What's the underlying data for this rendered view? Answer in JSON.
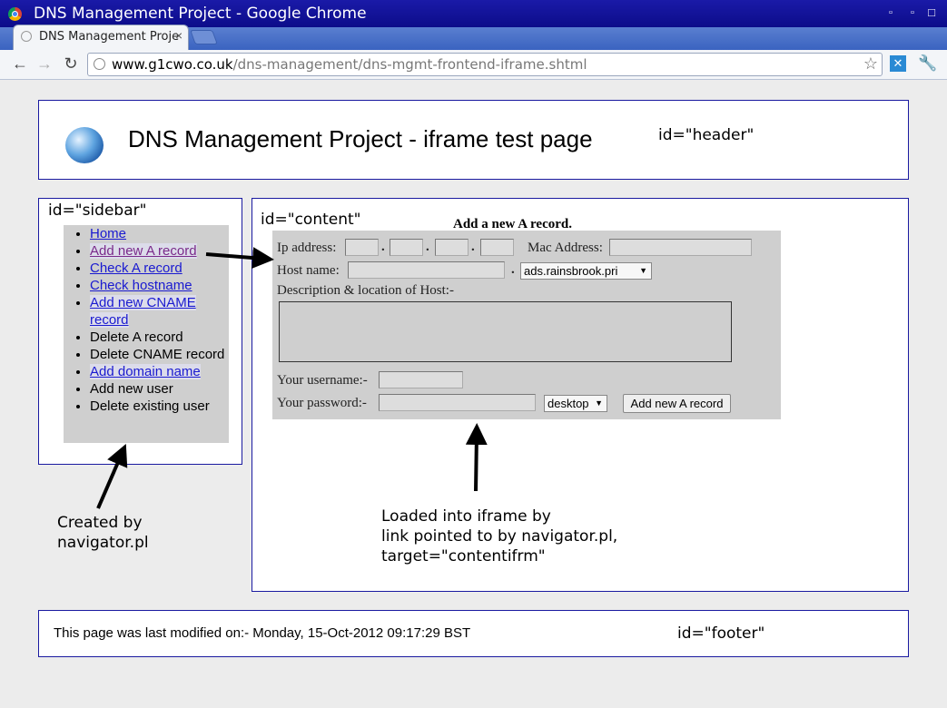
{
  "window": {
    "title": "DNS Management Project - Google Chrome",
    "min": "▫",
    "max": "▫",
    "close": "□"
  },
  "tab": {
    "title": "DNS Management Projec",
    "close": "×"
  },
  "toolbar": {
    "back": "←",
    "forward": "→",
    "reload": "↻",
    "url_domain": "www.g1cwo.co.uk",
    "url_path": "/dns-management/dns-mgmt-frontend-iframe.shtml",
    "star": "☆",
    "wrench": "🔧"
  },
  "header": {
    "title": "DNS Management Project - iframe test page",
    "id_label": "id=\"header\""
  },
  "sidebar": {
    "id_label": "id=\"sidebar\"",
    "items": [
      {
        "label": "Home",
        "link": true
      },
      {
        "label": "Add new A record",
        "link": true
      },
      {
        "label": "Check A record",
        "link": true
      },
      {
        "label": "Check hostname",
        "link": true
      },
      {
        "label": "Add new CNAME record",
        "link": true
      },
      {
        "label": "Delete A record",
        "link": false
      },
      {
        "label": "Delete CNAME record",
        "link": false
      },
      {
        "label": "Add domain name",
        "link": true
      },
      {
        "label": "Add new user",
        "link": false
      },
      {
        "label": "Delete existing user",
        "link": false
      }
    ]
  },
  "content": {
    "id_label": "id=\"content\""
  },
  "form": {
    "title": "Add a new A record.",
    "ip_label": "Ip address:",
    "dot": ".",
    "mac_label": "Mac Address:",
    "host_label": "Host name:",
    "domain_select": "ads.rainsbrook.pri",
    "desc_label": "Description & location of Host:-",
    "username_label": "Your username:-",
    "password_label": "Your password:-",
    "realm_select": "desktop",
    "submit": "Add new A record"
  },
  "annotations": {
    "sidebar_note": [
      "Created by",
      "navigator.pl"
    ],
    "iframe_note": [
      "Loaded into iframe by",
      "link pointed to by navigator.pl,",
      "target=\"contentifrm\""
    ]
  },
  "footer": {
    "text": "This page was last modified on:- Monday, 15-Oct-2012 09:17:29 BST",
    "id_label": "id=\"footer\""
  }
}
